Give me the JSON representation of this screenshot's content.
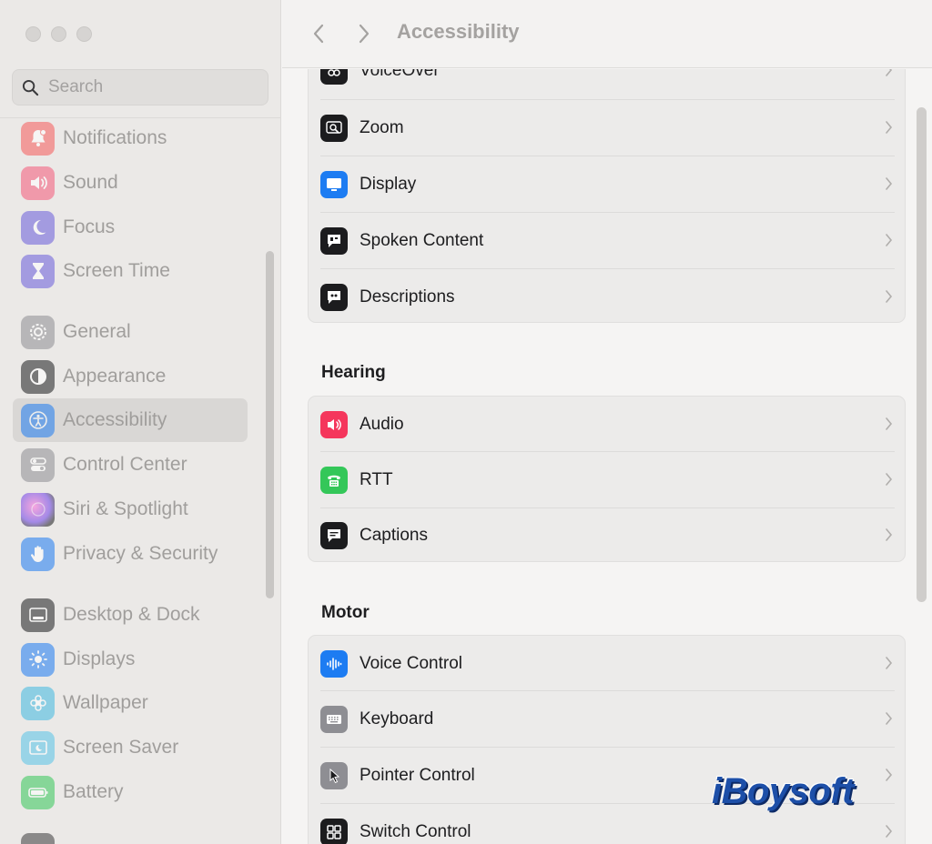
{
  "sidebar": {
    "search": {
      "placeholder": "Search"
    },
    "items": [
      {
        "label": "Notifications",
        "icon": "bell-icon",
        "color": "#f75a5a",
        "selected": false
      },
      {
        "label": "Sound",
        "icon": "speaker-icon",
        "color": "#f5587a",
        "selected": false
      },
      {
        "label": "Focus",
        "icon": "moon-icon",
        "color": "#6a5cdb",
        "selected": false
      },
      {
        "label": "Screen Time",
        "icon": "hourglass-icon",
        "color": "#6a5cdb",
        "selected": false
      },
      {
        "label": "General",
        "icon": "gear-icon",
        "color": "#8e8e93",
        "selected": false
      },
      {
        "label": "Appearance",
        "icon": "appearance-icon",
        "color": "#1c1c1e",
        "selected": false
      },
      {
        "label": "Accessibility",
        "icon": "accessibility-icon",
        "color": "#1d7cf2",
        "selected": true
      },
      {
        "label": "Control Center",
        "icon": "toggles-icon",
        "color": "#8e8e93",
        "selected": false
      },
      {
        "label": "Siri & Spotlight",
        "icon": "siri-icon",
        "color": "#a04ad8",
        "selected": false
      },
      {
        "label": "Privacy & Security",
        "icon": "hand-icon",
        "color": "#1d7cf2",
        "selected": false
      },
      {
        "label": "Desktop & Dock",
        "icon": "dock-icon",
        "color": "#1c1c1e",
        "selected": false
      },
      {
        "label": "Displays",
        "icon": "sun-icon",
        "color": "#1d7cf2",
        "selected": false
      },
      {
        "label": "Wallpaper",
        "icon": "flower-icon",
        "color": "#3fb8e0",
        "selected": false
      },
      {
        "label": "Screen Saver",
        "icon": "screensaver-icon",
        "color": "#57c3e8",
        "selected": false
      },
      {
        "label": "Battery",
        "icon": "battery-icon",
        "color": "#34c759",
        "selected": false
      }
    ]
  },
  "header": {
    "title": "Accessibility",
    "back_icon": "chevron-left-icon",
    "forward_icon": "chevron-right-icon"
  },
  "vision": {
    "rows": [
      {
        "label": "VoiceOver",
        "icon": "voiceover-icon",
        "color": "#1c1c1e"
      },
      {
        "label": "Zoom",
        "icon": "zoom-icon",
        "color": "#1c1c1e"
      },
      {
        "label": "Display",
        "icon": "display-icon",
        "color": "#1d7cf2"
      },
      {
        "label": "Spoken Content",
        "icon": "spoken-content-icon",
        "color": "#1c1c1e"
      },
      {
        "label": "Descriptions",
        "icon": "descriptions-icon",
        "color": "#1c1c1e"
      }
    ]
  },
  "hearing": {
    "title": "Hearing",
    "rows": [
      {
        "label": "Audio",
        "icon": "audio-icon",
        "color": "#f5365c"
      },
      {
        "label": "RTT",
        "icon": "rtt-icon",
        "color": "#34c759"
      },
      {
        "label": "Captions",
        "icon": "captions-icon",
        "color": "#1c1c1e"
      }
    ]
  },
  "motor": {
    "title": "Motor",
    "rows": [
      {
        "label": "Voice Control",
        "icon": "voice-control-icon",
        "color": "#1d7cf2"
      },
      {
        "label": "Keyboard",
        "icon": "keyboard-icon",
        "color": "#8e8e93"
      },
      {
        "label": "Pointer Control",
        "icon": "pointer-icon",
        "color": "#8e8e93"
      },
      {
        "label": "Switch Control",
        "icon": "switch-control-icon",
        "color": "#1c1c1e"
      }
    ]
  },
  "watermark": {
    "text": "iBoysoft"
  }
}
